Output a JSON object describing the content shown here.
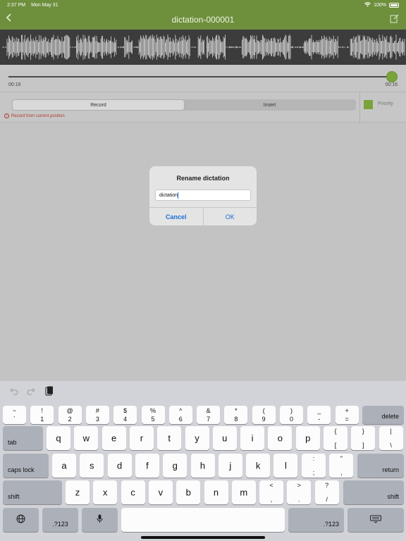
{
  "status_bar": {
    "time": "2:37 PM",
    "date": "Mon May 31",
    "battery": "100%"
  },
  "nav": {
    "title": "dictation-000001",
    "back_icon": "chevron-left-icon",
    "edit_icon": "edit-icon"
  },
  "playback": {
    "elapsed": "00:16",
    "total": "00:16",
    "progress": 1.0
  },
  "controls": {
    "tabs": [
      {
        "label": "Record",
        "active": true
      },
      {
        "label": "Insert",
        "active": false
      }
    ],
    "hint": "Record from current position",
    "priority_label": "Priority",
    "accent_color": "#7aa33a"
  },
  "dialog": {
    "title": "Rename dictation",
    "input_value": "dictation",
    "cancel_label": "Cancel",
    "ok_label": "OK"
  },
  "toolbar": {
    "undo_icon": "undo-icon",
    "redo_icon": "redo-icon",
    "paste_icon": "paste-icon"
  },
  "keyboard": {
    "number_row": [
      {
        "top": "~",
        "bottom": "`"
      },
      {
        "top": "!",
        "bottom": "1"
      },
      {
        "top": "@",
        "bottom": "2"
      },
      {
        "top": "#",
        "bottom": "3"
      },
      {
        "top": "$",
        "bottom": "4"
      },
      {
        "top": "%",
        "bottom": "5"
      },
      {
        "top": "^",
        "bottom": "6"
      },
      {
        "top": "&",
        "bottom": "7"
      },
      {
        "top": "*",
        "bottom": "8"
      },
      {
        "top": "(",
        "bottom": "9"
      },
      {
        "top": ")",
        "bottom": "0"
      },
      {
        "top": "_",
        "bottom": "-"
      },
      {
        "top": "+",
        "bottom": "="
      }
    ],
    "delete_label": "delete",
    "tab_label": "tab",
    "row_q": [
      "q",
      "w",
      "e",
      "r",
      "t",
      "y",
      "u",
      "i",
      "o",
      "p"
    ],
    "row_q_extra": [
      {
        "top": "{",
        "bottom": "["
      },
      {
        "top": "}",
        "bottom": "]"
      },
      {
        "top": "|",
        "bottom": "\\"
      }
    ],
    "caps_label": "caps lock",
    "row_a": [
      "a",
      "s",
      "d",
      "f",
      "g",
      "h",
      "j",
      "k",
      "l"
    ],
    "row_a_extra": [
      {
        "top": ":",
        "bottom": ";"
      },
      {
        "top": "\"",
        "bottom": ","
      }
    ],
    "return_label": "return",
    "shift_label": "shift",
    "row_z": [
      "z",
      "x",
      "c",
      "v",
      "b",
      "n",
      "m"
    ],
    "row_z_extra": [
      {
        "top": "<",
        "bottom": ","
      },
      {
        "top": ">",
        "bottom": "."
      },
      {
        "top": "?",
        "bottom": "/"
      }
    ],
    "mode_label": ".?123",
    "globe_icon": "globe-icon",
    "mic_icon": "microphone-icon",
    "hide_icon": "keyboard-hide-icon"
  }
}
